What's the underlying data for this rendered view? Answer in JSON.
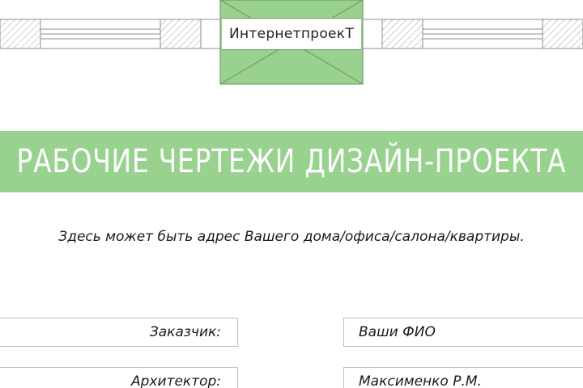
{
  "logo": {
    "text": "ИнтернетпроекТ",
    "accent_color": "#99d18f"
  },
  "banner": {
    "title": "РАБОЧИЕ ЧЕРТЕЖИ ДИЗАЙН-ПРОЕКТА",
    "background_color": "#99d18f"
  },
  "address": {
    "text": "Здесь может быть адрес Вашего дома/офиса/салона/квартиры."
  },
  "fields": [
    {
      "label": "Заказчик:",
      "value": "Ваши ФИО"
    },
    {
      "label": "Архитектор:",
      "value": "Максименко Р.М."
    }
  ]
}
